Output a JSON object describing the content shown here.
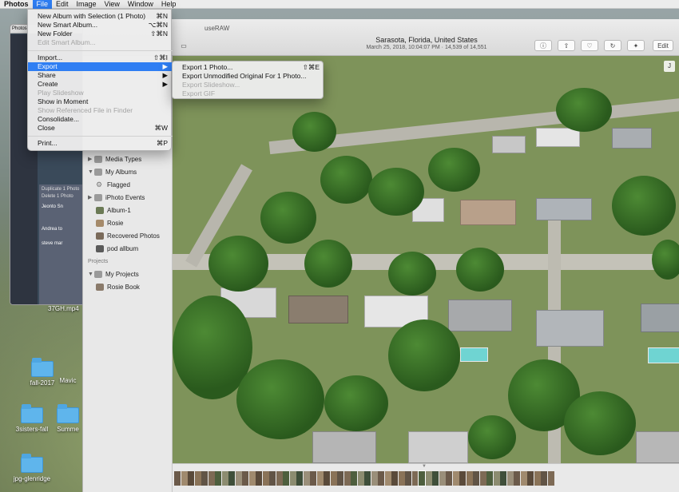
{
  "menubar": {
    "items": [
      "Photos",
      "File",
      "Edit",
      "Image",
      "View",
      "Window",
      "Help"
    ],
    "active": "File"
  },
  "file_menu": {
    "items": [
      {
        "label": "New Album with Selection (1 Photo)",
        "shortcut": "⌘N",
        "enabled": true
      },
      {
        "label": "New Smart Album...",
        "shortcut": "⌥⌘N",
        "enabled": true
      },
      {
        "label": "New Folder",
        "shortcut": "⇧⌘N",
        "enabled": true
      },
      {
        "label": "Edit Smart Album...",
        "shortcut": "",
        "enabled": false
      },
      {
        "label": "Import...",
        "shortcut": "⇧⌘I",
        "enabled": true
      },
      {
        "label": "Export",
        "shortcut": "▶",
        "enabled": true,
        "selected": true
      },
      {
        "label": "Share",
        "shortcut": "▶",
        "enabled": true
      },
      {
        "label": "Create",
        "shortcut": "▶",
        "enabled": true
      },
      {
        "label": "Play Slideshow",
        "shortcut": "",
        "enabled": false
      },
      {
        "label": "Show in Moment",
        "shortcut": "",
        "enabled": true
      },
      {
        "label": "Show Referenced File in Finder",
        "shortcut": "",
        "enabled": false
      },
      {
        "label": "Consolidate...",
        "shortcut": "",
        "enabled": true
      },
      {
        "label": "Close",
        "shortcut": "⌘W",
        "enabled": true
      },
      {
        "label": "Print...",
        "shortcut": "⌘P",
        "enabled": true
      }
    ]
  },
  "export_submenu": {
    "items": [
      {
        "label": "Export 1 Photo...",
        "shortcut": "⇧⌘E",
        "enabled": true
      },
      {
        "label": "Export Unmodified Original For 1 Photo...",
        "shortcut": "",
        "enabled": true
      },
      {
        "label": "Export Slideshow...",
        "shortcut": "",
        "enabled": false
      },
      {
        "label": "Export GIF",
        "shortcut": "",
        "enabled": false
      }
    ]
  },
  "window": {
    "name": "useRAW",
    "location": "Sarasota, Florida, United States",
    "subtitle": "March 25, 2018, 10:04:07 PM  ·  14,539 of 14,551",
    "edit_label": "Edit",
    "badge": "J"
  },
  "sidebar": {
    "items": [
      {
        "label": "Media Types"
      },
      {
        "label": "My Albums"
      },
      {
        "label": "Flagged"
      },
      {
        "label": "iPhoto Events"
      },
      {
        "label": "Album-1"
      },
      {
        "label": "Rosie"
      },
      {
        "label": "Recovered Photos"
      },
      {
        "label": "pod allbum"
      }
    ],
    "projects_header": "Projects",
    "projects": [
      {
        "label": "My Projects"
      },
      {
        "label": "Rosie Book"
      }
    ]
  },
  "desktop": {
    "icons": [
      "fall-2017",
      "Mavic",
      "3sisters-fall",
      "Summe",
      "jpg-glenridge"
    ],
    "file_label": "37GH.mp4",
    "bg_window_labels": [
      "Photos",
      "Duplicate 1 Photo",
      "Delete 1 Photo",
      "Jeonto Sn",
      "Andrea to",
      "steve mar"
    ]
  },
  "colors": {
    "accent": "#2f7ef3"
  }
}
